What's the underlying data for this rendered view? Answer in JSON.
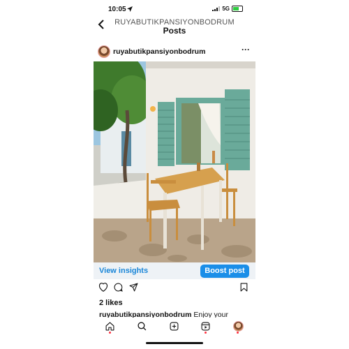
{
  "status_bar": {
    "time": "10:05",
    "network": "5G"
  },
  "header": {
    "username": "RUYABUTIKPANSIYONBODRUM",
    "title": "Posts"
  },
  "post": {
    "username": "ruyabutikpansiyonbodrum",
    "likes": "2 likes",
    "caption_user": "ruyabutikpansiyonbodrum",
    "caption_text": "Enjoy your"
  },
  "insights": {
    "view_label": "View insights",
    "boost_label": "Boost post"
  },
  "colors": {
    "accent": "#1a8ee8",
    "link": "#1a86d8",
    "notification": "#ff3040",
    "shutters": "#6aaa9a"
  },
  "icons": {
    "header": [
      "back-arrow-icon",
      "more-icon"
    ],
    "actions": [
      "heart-icon",
      "comment-icon",
      "share-icon",
      "bookmark-icon"
    ],
    "tabbar": [
      "home-icon",
      "search-icon",
      "create-icon",
      "reels-icon",
      "profile-avatar"
    ]
  }
}
